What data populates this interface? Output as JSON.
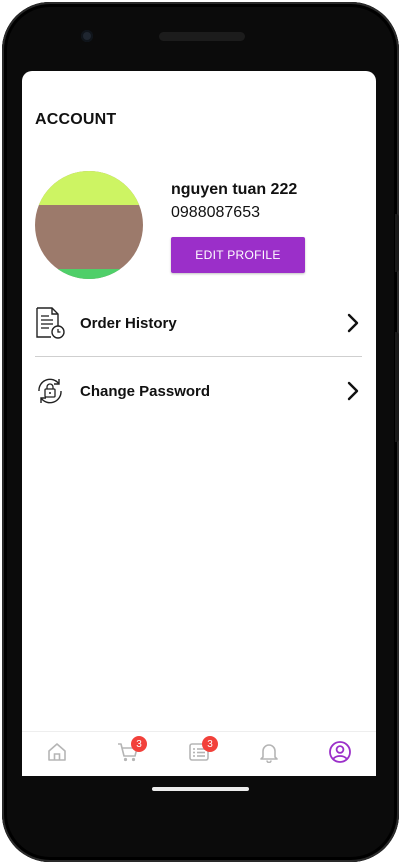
{
  "header": {
    "title": "ACCOUNT"
  },
  "profile": {
    "name": "nguyen tuan 222",
    "phone": "0988087653",
    "edit_label": "EDIT PROFILE"
  },
  "menu": [
    {
      "label": "Order History",
      "icon": "order-history-icon"
    },
    {
      "label": "Change Password",
      "icon": "lock-refresh-icon"
    }
  ],
  "bottom_nav": {
    "items": [
      {
        "name": "home",
        "icon": "home-icon",
        "active": false
      },
      {
        "name": "cart",
        "icon": "cart-icon",
        "active": false,
        "badge": "3"
      },
      {
        "name": "orders",
        "icon": "list-icon",
        "active": false,
        "badge": "3"
      },
      {
        "name": "notifications",
        "icon": "bell-icon",
        "active": false
      },
      {
        "name": "account",
        "icon": "user-circle-icon",
        "active": true
      }
    ]
  },
  "colors": {
    "accent": "#9b2fc9",
    "badge": "#f2413b",
    "inactive_icon": "#b5b5b5"
  }
}
